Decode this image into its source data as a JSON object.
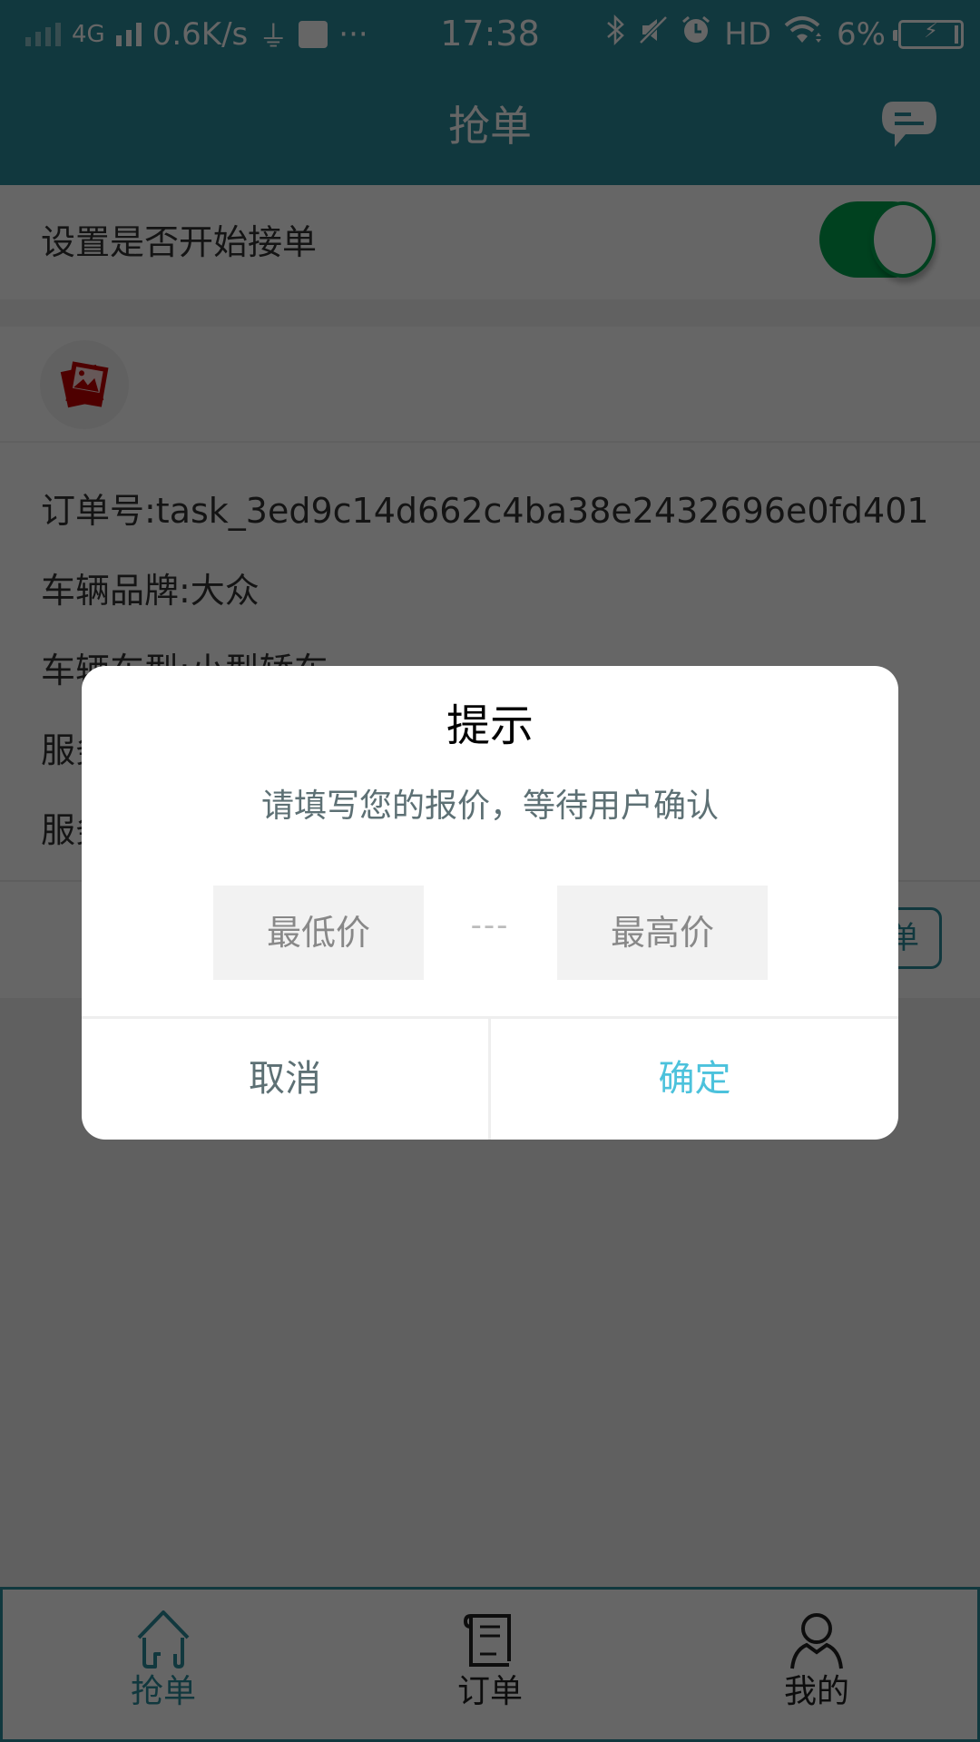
{
  "status_bar": {
    "network_type": "4G",
    "net_speed": "0.6K/s",
    "more": "···",
    "time": "17:38",
    "hd": "HD",
    "battery_percent": "6%",
    "battery_charging": true,
    "icons": [
      "signal-weak-icon",
      "signal-icon",
      "usb-icon",
      "usb-debug-icon",
      "bluetooth-icon",
      "mute-icon",
      "alarm-icon",
      "wifi-icon",
      "battery-icon"
    ]
  },
  "header": {
    "title": "抢单",
    "message_icon": "message-icon"
  },
  "settings": {
    "accept_orders_label": "设置是否开始接单",
    "accept_orders_enabled": true
  },
  "order": {
    "image_icon": "image-placeholder-icon",
    "lines": [
      "订单号:task_3ed9c14d662c4ba38e2432696e0fd401",
      "车辆品牌:大众",
      "车辆车型:小型轿车",
      "服务",
      "服务"
    ],
    "grab_button_label": "抢单"
  },
  "dialog": {
    "title": "提示",
    "message": "请填写您的报价，等待用户确认",
    "min_price": {
      "value": "",
      "placeholder": "最低价"
    },
    "separator": "---",
    "max_price": {
      "value": "",
      "placeholder": "最高价"
    },
    "cancel_label": "取消",
    "confirm_label": "确定"
  },
  "tabbar": {
    "tabs": [
      {
        "label": "抢单",
        "icon": "home-icon",
        "active": true
      },
      {
        "label": "订单",
        "icon": "order-list-icon",
        "active": false
      },
      {
        "label": "我的",
        "icon": "user-icon",
        "active": false
      }
    ]
  },
  "colors": {
    "brand": "#2c8c9c",
    "toggle_on": "#00a24e",
    "confirm": "#4cc2dc",
    "overlay": "rgba(0,0,0,0.6)"
  }
}
